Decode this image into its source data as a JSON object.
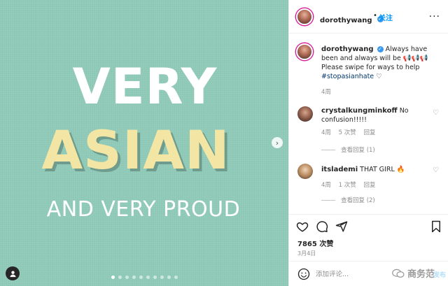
{
  "post": {
    "text_line1": "VERY",
    "text_line2": "ASIAN",
    "text_line3": "AND VERY PROUD",
    "carousel_dot_count": 10,
    "carousel_active_index": 0,
    "background_color": "#8dc8b6",
    "accent_color": "#f3e6a4"
  },
  "header": {
    "username": "dorothywang",
    "separator": "•",
    "follow_label": "关注",
    "more_label": "..."
  },
  "caption": {
    "username": "dorothywang",
    "text": "Always have been and always will be 📢📢📢 Please swipe for ways to help",
    "hashtag": "#stopasianhate",
    "heart": "♡",
    "time": "4周"
  },
  "comments": [
    {
      "username": "crystalkungminkoff",
      "text": "No confusion!!!!!",
      "time": "4周",
      "likes": "5 次赞",
      "reply_label": "回复",
      "view_replies": "查看回复 (1)"
    },
    {
      "username": "itslademi",
      "text": "THAT GIRL 🔥",
      "time": "4周",
      "likes": "1 次赞",
      "reply_label": "回复",
      "view_replies": "查看回复 (2)"
    }
  ],
  "actions": {
    "likes_count": "7865 次赞",
    "date": "3月4日"
  },
  "comment_box": {
    "placeholder": "添加评论...",
    "post_label": "发布"
  },
  "watermark": {
    "text": "商务范"
  },
  "colors": {
    "link_blue": "#0095f6",
    "verified_blue": "#3897f0",
    "muted_gray": "#8e8e8e"
  }
}
